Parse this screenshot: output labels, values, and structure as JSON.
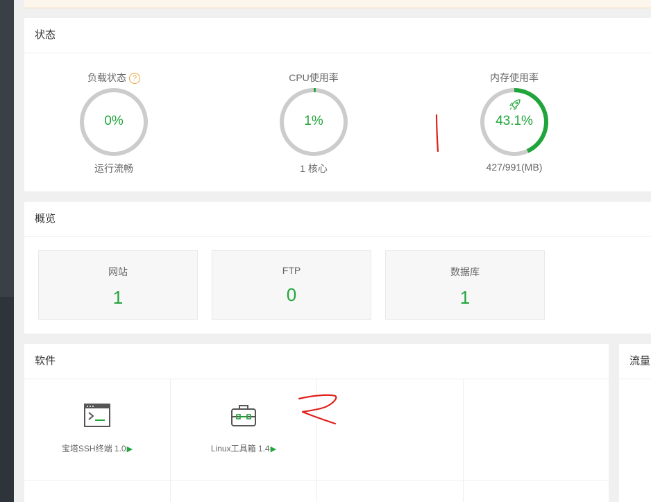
{
  "status": {
    "title": "状态",
    "load": {
      "label": "负载状态",
      "help": "?",
      "value": "0%",
      "percent": 0,
      "sub": "运行流畅"
    },
    "cpu": {
      "label": "CPU使用率",
      "value": "1%",
      "percent": 1,
      "sub": "1 核心"
    },
    "memory": {
      "label": "内存使用率",
      "value": "43.1%",
      "percent": 43.1,
      "sub": "427/991(MB)"
    }
  },
  "overview": {
    "title": "概览",
    "cards": [
      {
        "label": "网站",
        "value": "1"
      },
      {
        "label": "FTP",
        "value": "0"
      },
      {
        "label": "数据库",
        "value": "1"
      }
    ]
  },
  "software": {
    "title": "软件",
    "items": [
      {
        "name": "宝塔SSH终端 1.0",
        "icon": "terminal-icon"
      },
      {
        "name": "Linux工具箱 1.4",
        "icon": "toolbox-icon"
      }
    ]
  },
  "traffic": {
    "title": "流量"
  },
  "colors": {
    "accent": "#20a53a",
    "ring_bg": "#cccccc",
    "annotation": "#e0201a"
  }
}
